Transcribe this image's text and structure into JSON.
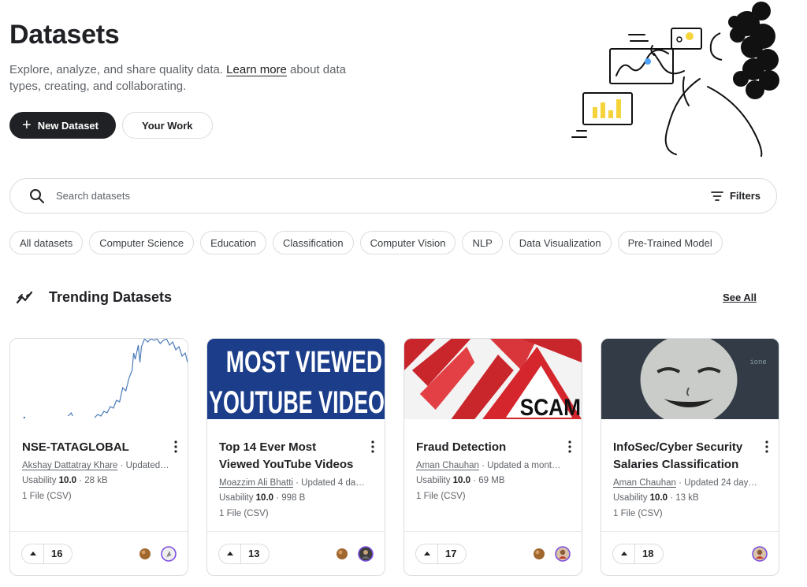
{
  "header": {
    "title": "Datasets",
    "description_before": "Explore, analyze, and share quality data. ",
    "learn_more": "Learn more",
    "description_after": " about data types, creating, and collaborating.",
    "new_dataset_label": "New Dataset",
    "your_work_label": "Your Work"
  },
  "search": {
    "placeholder": "Search datasets",
    "filters_label": "Filters"
  },
  "chips": [
    "All datasets",
    "Computer Science",
    "Education",
    "Classification",
    "Computer Vision",
    "NLP",
    "Data Visualization",
    "Pre-Trained Model"
  ],
  "trending": {
    "title": "Trending Datasets",
    "see_all": "See All"
  },
  "cards": [
    {
      "title": "NSE-TATAGLOBAL",
      "owner": "Akshay Dattatray Khare",
      "updated": " · Updated…",
      "usability_label": "Usability ",
      "usability": "10.0",
      "size": " · 28 kB",
      "files": "1 File (CSV)",
      "votes": "16"
    },
    {
      "title": "Top 14 Ever Most Viewed YouTube Videos",
      "owner": "Moazzim Ali Bhatti",
      "updated": " · Updated 4 da…",
      "usability_label": "Usability ",
      "usability": "10.0",
      "size": " · 998 B",
      "files": "1 File (CSV)",
      "votes": "13",
      "thumb_line1": "MOST VIEWED",
      "thumb_line2": "YOUTUBE VIDEO"
    },
    {
      "title": "Fraud Detection",
      "owner": "Aman Chauhan",
      "updated": " · Updated a mont…",
      "usability_label": "Usability ",
      "usability": "10.0",
      "size": " · 69 MB",
      "files": "1 File (CSV)",
      "votes": "17",
      "thumb_text": "SCAM"
    },
    {
      "title": "InfoSec/Cyber Security Salaries Classification",
      "owner": "Aman Chauhan",
      "updated": " · Updated 24 day…",
      "usability_label": "Usability ",
      "usability": "10.0",
      "size": " · 13 kB",
      "files": "1 File (CSV)",
      "votes": "18"
    }
  ],
  "colors": {
    "primary": "#202124",
    "border": "#dadce0",
    "muted_text": "#5f6368",
    "youtube_banner": "#1c3d8a"
  },
  "icons": {
    "search": "search-icon",
    "filters": "filter-lines-icon",
    "trending": "trending-line-icon",
    "upvote": "caret-up-icon",
    "more": "kebab-vertical-icon"
  }
}
